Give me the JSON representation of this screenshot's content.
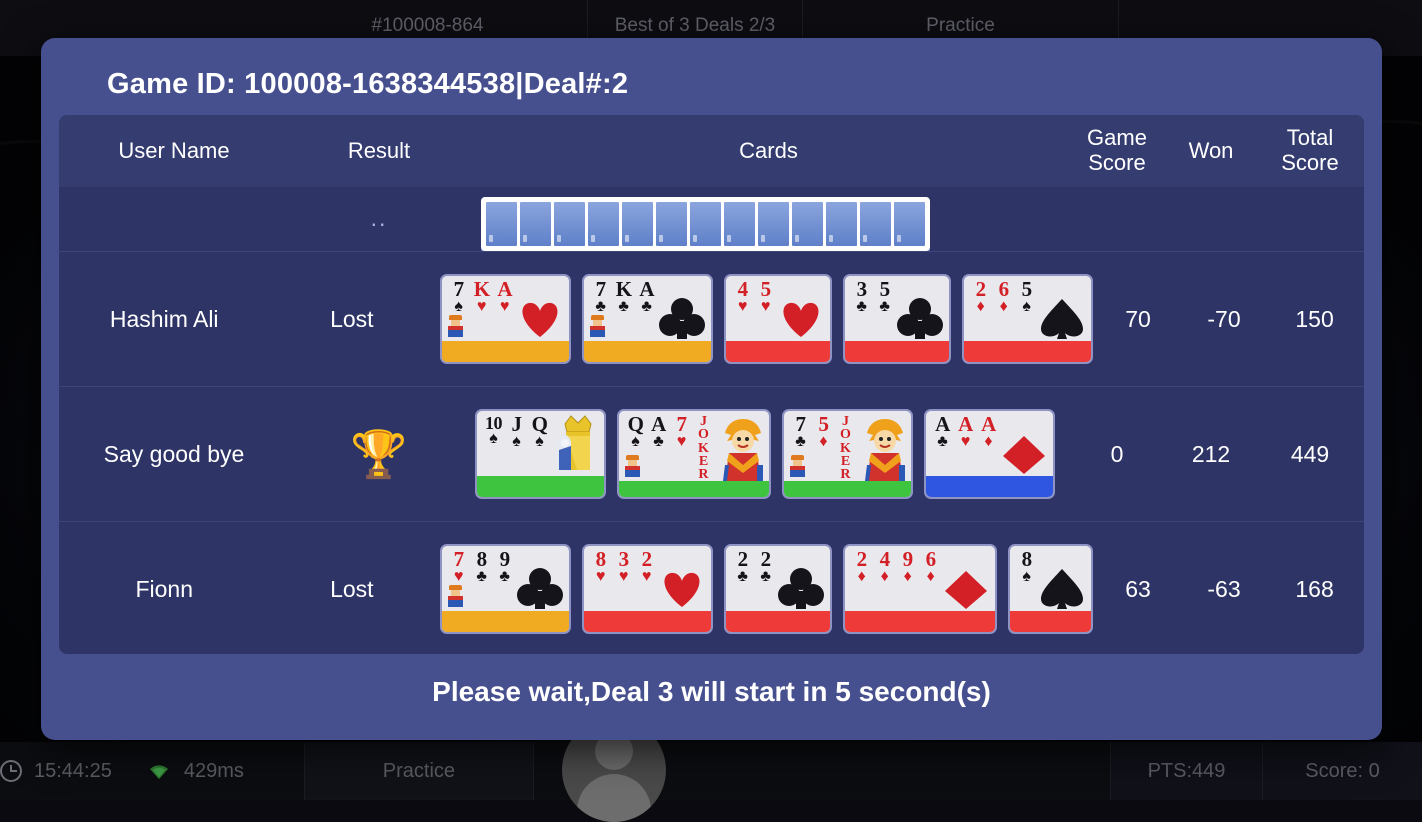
{
  "background": {
    "topbar": {
      "game_id": "#100008-864",
      "deals": "Best of 3 Deals 2/3",
      "mode": "Practice"
    },
    "statusbar": {
      "clock_icon": "clock-icon",
      "time": "15:44:25",
      "wifi_icon": "wifi-icon",
      "ping": "429ms",
      "mode": "Practice",
      "pts": "PTS:449",
      "score": "Score: 0"
    }
  },
  "modal": {
    "title": "Game ID: 100008-1638344538|Deal#:2",
    "footer_message": "Please wait,Deal 3 will start in 5 second(s)",
    "colors": {
      "dialog_bg": "#47508f",
      "table_bg": "#2e3566",
      "header_bg": "#343c70",
      "bar_yellow": "#f0ab22",
      "bar_red": "#ee3b39",
      "bar_green": "#3fc43f",
      "bar_blue": "#2f56e0",
      "card_face": "#e9e9ed",
      "red_suit": "#d31f26",
      "black_suit": "#14141a"
    },
    "table": {
      "headers": {
        "user_name": "User Name",
        "result": "Result",
        "cards": "Cards",
        "game_score": "Game\nScore",
        "game_score_l1": "Game",
        "game_score_l2": "Score",
        "won": "Won",
        "total_score": "Total\nScore",
        "total_score_l1": "Total",
        "total_score_l2": "Score"
      },
      "rows": [
        {
          "clipped": true,
          "user_name": "",
          "result": "",
          "facedown_count": 13,
          "game_score": "",
          "won": "",
          "total_score": ""
        },
        {
          "clipped": false,
          "user_name": "Hashim Ali",
          "result": "Lost",
          "result_type": "text",
          "game_score": "70",
          "won": "-70",
          "total_score": "150",
          "melds": [
            {
              "bar": "yellow",
              "figure": "heart",
              "token": true,
              "cards": [
                {
                  "rank": "7",
                  "suit": "spade",
                  "color": "black"
                },
                {
                  "rank": "K",
                  "suit": "heart",
                  "color": "red"
                },
                {
                  "rank": "A",
                  "suit": "heart",
                  "color": "red"
                }
              ]
            },
            {
              "bar": "yellow",
              "figure": "club",
              "token": true,
              "cards": [
                {
                  "rank": "7",
                  "suit": "club",
                  "color": "black"
                },
                {
                  "rank": "K",
                  "suit": "club",
                  "color": "black"
                },
                {
                  "rank": "A",
                  "suit": "club",
                  "color": "black"
                }
              ]
            },
            {
              "bar": "red",
              "figure": "heart",
              "token": false,
              "cards": [
                {
                  "rank": "4",
                  "suit": "heart",
                  "color": "red"
                },
                {
                  "rank": "5",
                  "suit": "heart",
                  "color": "red"
                }
              ]
            },
            {
              "bar": "red",
              "figure": "club",
              "token": false,
              "cards": [
                {
                  "rank": "3",
                  "suit": "club",
                  "color": "black"
                },
                {
                  "rank": "5",
                  "suit": "club",
                  "color": "black"
                }
              ]
            },
            {
              "bar": "red",
              "figure": "spade",
              "token": false,
              "cards": [
                {
                  "rank": "2",
                  "suit": "diamond",
                  "color": "red"
                },
                {
                  "rank": "6",
                  "suit": "diamond",
                  "color": "red"
                },
                {
                  "rank": "5",
                  "suit": "spade",
                  "color": "black"
                }
              ]
            }
          ]
        },
        {
          "clipped": false,
          "user_name": "Say good bye",
          "result": "🏆",
          "result_type": "trophy",
          "result_icon": "trophy-icon",
          "game_score": "0",
          "won": "212",
          "total_score": "449",
          "melds": [
            {
              "bar": "green",
              "figure": "queen",
              "token": false,
              "cards": [
                {
                  "rank": "10",
                  "suit": "spade",
                  "color": "black"
                },
                {
                  "rank": "J",
                  "suit": "spade",
                  "color": "black"
                },
                {
                  "rank": "Q",
                  "suit": "spade",
                  "color": "black"
                }
              ]
            },
            {
              "bar": "green",
              "figure": "joker",
              "token": true,
              "cards": [
                {
                  "rank": "Q",
                  "suit": "spade",
                  "color": "black"
                },
                {
                  "rank": "A",
                  "suit": "club",
                  "color": "black"
                },
                {
                  "rank": "7",
                  "suit": "heart",
                  "color": "red"
                },
                {
                  "rank": "JOKER",
                  "suit": "joker",
                  "color": "red"
                }
              ]
            },
            {
              "bar": "green",
              "figure": "joker",
              "token": true,
              "cards": [
                {
                  "rank": "7",
                  "suit": "club",
                  "color": "black"
                },
                {
                  "rank": "5",
                  "suit": "diamond",
                  "color": "red"
                },
                {
                  "rank": "JOKER",
                  "suit": "joker",
                  "color": "red"
                }
              ]
            },
            {
              "bar": "blue",
              "figure": "diamond",
              "token": false,
              "cards": [
                {
                  "rank": "A",
                  "suit": "club",
                  "color": "black"
                },
                {
                  "rank": "A",
                  "suit": "heart",
                  "color": "red"
                },
                {
                  "rank": "A",
                  "suit": "diamond",
                  "color": "red"
                }
              ]
            }
          ]
        },
        {
          "clipped": false,
          "user_name": "Fionn",
          "result": "Lost",
          "result_type": "text",
          "game_score": "63",
          "won": "-63",
          "total_score": "168",
          "melds": [
            {
              "bar": "yellow",
              "figure": "club",
              "token": true,
              "cards": [
                {
                  "rank": "7",
                  "suit": "heart",
                  "color": "red"
                },
                {
                  "rank": "8",
                  "suit": "club",
                  "color": "black"
                },
                {
                  "rank": "9",
                  "suit": "club",
                  "color": "black"
                }
              ]
            },
            {
              "bar": "red",
              "figure": "heart",
              "token": false,
              "cards": [
                {
                  "rank": "8",
                  "suit": "heart",
                  "color": "red"
                },
                {
                  "rank": "3",
                  "suit": "heart",
                  "color": "red"
                },
                {
                  "rank": "2",
                  "suit": "heart",
                  "color": "red"
                }
              ]
            },
            {
              "bar": "red",
              "figure": "club",
              "token": false,
              "cards": [
                {
                  "rank": "2",
                  "suit": "club",
                  "color": "black"
                },
                {
                  "rank": "2",
                  "suit": "club",
                  "color": "black"
                }
              ]
            },
            {
              "bar": "red",
              "figure": "diamond",
              "token": false,
              "cards": [
                {
                  "rank": "2",
                  "suit": "diamond",
                  "color": "red"
                },
                {
                  "rank": "4",
                  "suit": "diamond",
                  "color": "red"
                },
                {
                  "rank": "9",
                  "suit": "diamond",
                  "color": "red"
                },
                {
                  "rank": "6",
                  "suit": "diamond",
                  "color": "red"
                }
              ]
            },
            {
              "bar": "red",
              "figure": "spade",
              "token": false,
              "cards": [
                {
                  "rank": "8",
                  "suit": "spade",
                  "color": "black"
                }
              ]
            }
          ]
        }
      ]
    }
  }
}
